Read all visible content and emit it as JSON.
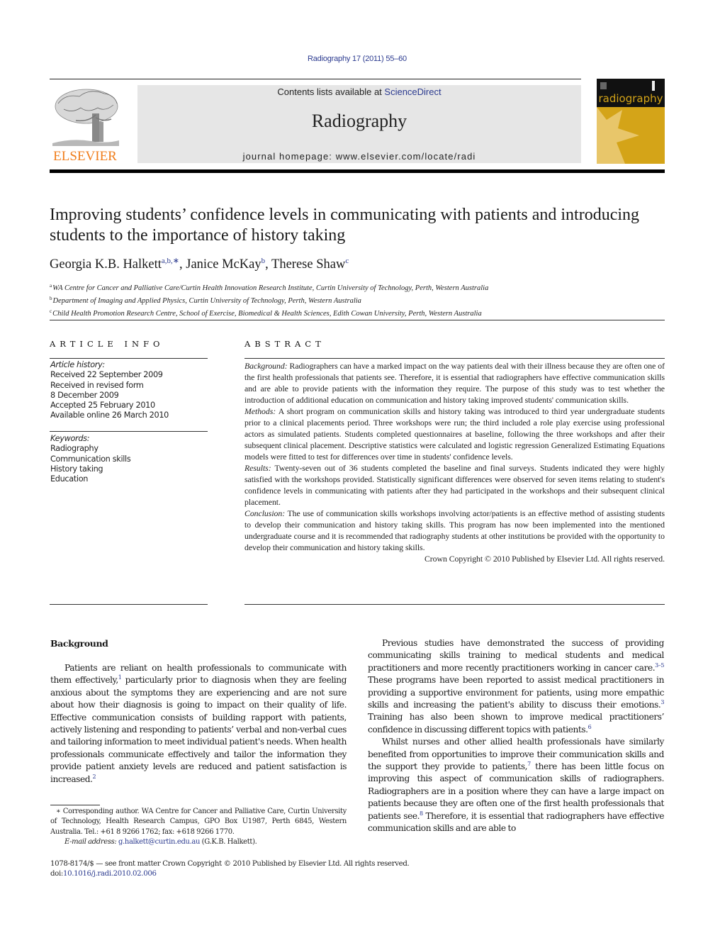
{
  "running_head": "Radiography 17 (2011) 55–60",
  "masthead": {
    "publisher_logo_text": "ELSEVIER",
    "contents_prefix": "Contents lists available at ",
    "contents_link": "ScienceDirect",
    "journal_title": "Radiography",
    "homepage_line": "journal homepage: www.elsevier.com/locate/radi",
    "cover_title": "radiography",
    "colors": {
      "elsevier_orange": "#f07d1b",
      "link_blue": "#2b3a8f",
      "cover_gold": "#d4a418",
      "cover_light": "#e8c66a",
      "masthead_gray": "#e6e6e6"
    }
  },
  "article": {
    "title": "Improving students’ confidence levels in communicating with patients and introducing students to the importance of history taking",
    "authors": [
      {
        "name": "Georgia K.B. Halkett",
        "affil": "a,b,∗",
        "sep": ", "
      },
      {
        "name": "Janice McKay",
        "affil": "b",
        "sep": ", "
      },
      {
        "name": "Therese Shaw",
        "affil": "c",
        "sep": ""
      }
    ],
    "affiliations": [
      {
        "mark": "a",
        "text": "WA Centre for Cancer and Palliative Care/Curtin Health Innovation Research Institute, Curtin University of Technology, Perth, Western Australia"
      },
      {
        "mark": "b",
        "text": "Department of Imaging and Applied Physics, Curtin University of Technology, Perth, Western Australia"
      },
      {
        "mark": "c",
        "text": "Child Health Promotion Research Centre, School of Exercise, Biomedical & Health Sciences, Edith Cowan University, Perth, Western Australia"
      }
    ]
  },
  "article_info": {
    "heading": "ARTICLE INFO",
    "history_label": "Article history:",
    "history": [
      "Received 22 September 2009",
      "Received in revised form",
      "8 December 2009",
      "Accepted 25 February 2010",
      "Available online 26 March 2010"
    ],
    "keywords_label": "Keywords:",
    "keywords": [
      "Radiography",
      "Communication skills",
      "History taking",
      "Education"
    ]
  },
  "abstract": {
    "heading": "ABSTRACT",
    "sections": [
      {
        "label": "Background:",
        "text": " Radiographers can have a marked impact on the way patients deal with their illness because they are often one of the first health professionals that patients see. Therefore, it is essential that radiographers have effective communication skills and are able to provide patients with the information they require. The purpose of this study was to test whether the introduction of additional education on communication and history taking improved students' communication skills."
      },
      {
        "label": "Methods:",
        "text": " A short program on communication skills and history taking was introduced to third year undergraduate students prior to a clinical placements period. Three workshops were run; the third included a role play exercise using professional actors as simulated patients. Students completed questionnaires at baseline, following the three workshops and after their subsequent clinical placement. Descriptive statistics were calculated and logistic regression Generalized Estimating Equations models were fitted to test for differences over time in students' confidence levels."
      },
      {
        "label": "Results:",
        "text": " Twenty-seven out of 36 students completed the baseline and final surveys. Students indicated they were highly satisfied with the workshops provided. Statistically significant differences were observed for seven items relating to student's confidence levels in communicating with patients after they had participated in the workshops and their subsequent clinical placement."
      },
      {
        "label": "Conclusion:",
        "text": " The use of communication skills workshops involving actor/patients is an effective method of assisting students to develop their communication and history taking skills. This program has now been implemented into the mentioned undergraduate course and it is recommended that radiography students at other institutions be provided with the opportunity to develop their communication and history taking skills."
      }
    ],
    "copyright": "Crown Copyright © 2010 Published by Elsevier Ltd. All rights reserved."
  },
  "body": {
    "section_heading": "Background",
    "left_paragraph": {
      "p1a": "Patients are reliant on health professionals to communicate with them effectively,",
      "ref1": "1",
      "p1b": " particularly prior to diagnosis when they are feeling anxious about the symptoms they are experiencing and are not sure about how their diagnosis is going to impact on their quality of life. Effective communication consists of building rapport with patients, actively listening and responding to patients’ verbal and non-verbal cues and tailoring information to meet individual patient's needs. When health professionals communicate effectively and tailor the information they provide patient anxiety levels are reduced and patient satisfaction is increased.",
      "ref2": "2"
    },
    "right_p1": {
      "a": "Previous studies have demonstrated the success of providing communicating skills training to medical students and medical practitioners and more recently practitioners working in cancer care.",
      "ref_a": "3–5",
      "b": " These programs have been reported to assist medical practitioners in providing a supportive environment for patients, using more empathic skills and increasing the patient's ability to discuss their emotions.",
      "ref_b": "3",
      "c": " Training has also been shown to improve medical practitioners’ confidence in discussing different topics with patients.",
      "ref_c": "6"
    },
    "right_p2": {
      "a": "Whilst nurses and other allied health professionals have similarly benefited from opportunities to improve their communication skills and the support they provide to patients,",
      "ref_a": "7",
      "b": " there has been little focus on improving this aspect of communication skills of radiographers. Radiographers are in a position where they can have a large impact on patients because they are often one of the first health professionals that patients see.",
      "ref_b": "8",
      "c": " Therefore, it is essential that radiographers have effective communication skills and are able to"
    }
  },
  "footnote": {
    "corresponding": "∗ Corresponding author. WA Centre for Cancer and Palliative Care, Curtin University of Technology, Health Research Campus, GPO Box U1987, Perth 6845, Western Australia. Tel.: +61 8 9266 1762; fax: +618 9266 1770.",
    "email_label": "E-mail address:",
    "email": "g.halkett@curtin.edu.au",
    "email_suffix": " (G.K.B. Halkett)."
  },
  "imprint": {
    "issn_line": "1078-8174/$ — see front matter Crown Copyright © 2010 Published by Elsevier Ltd. All rights reserved.",
    "doi_prefix": "doi:",
    "doi": "10.1016/j.radi.2010.02.006"
  }
}
